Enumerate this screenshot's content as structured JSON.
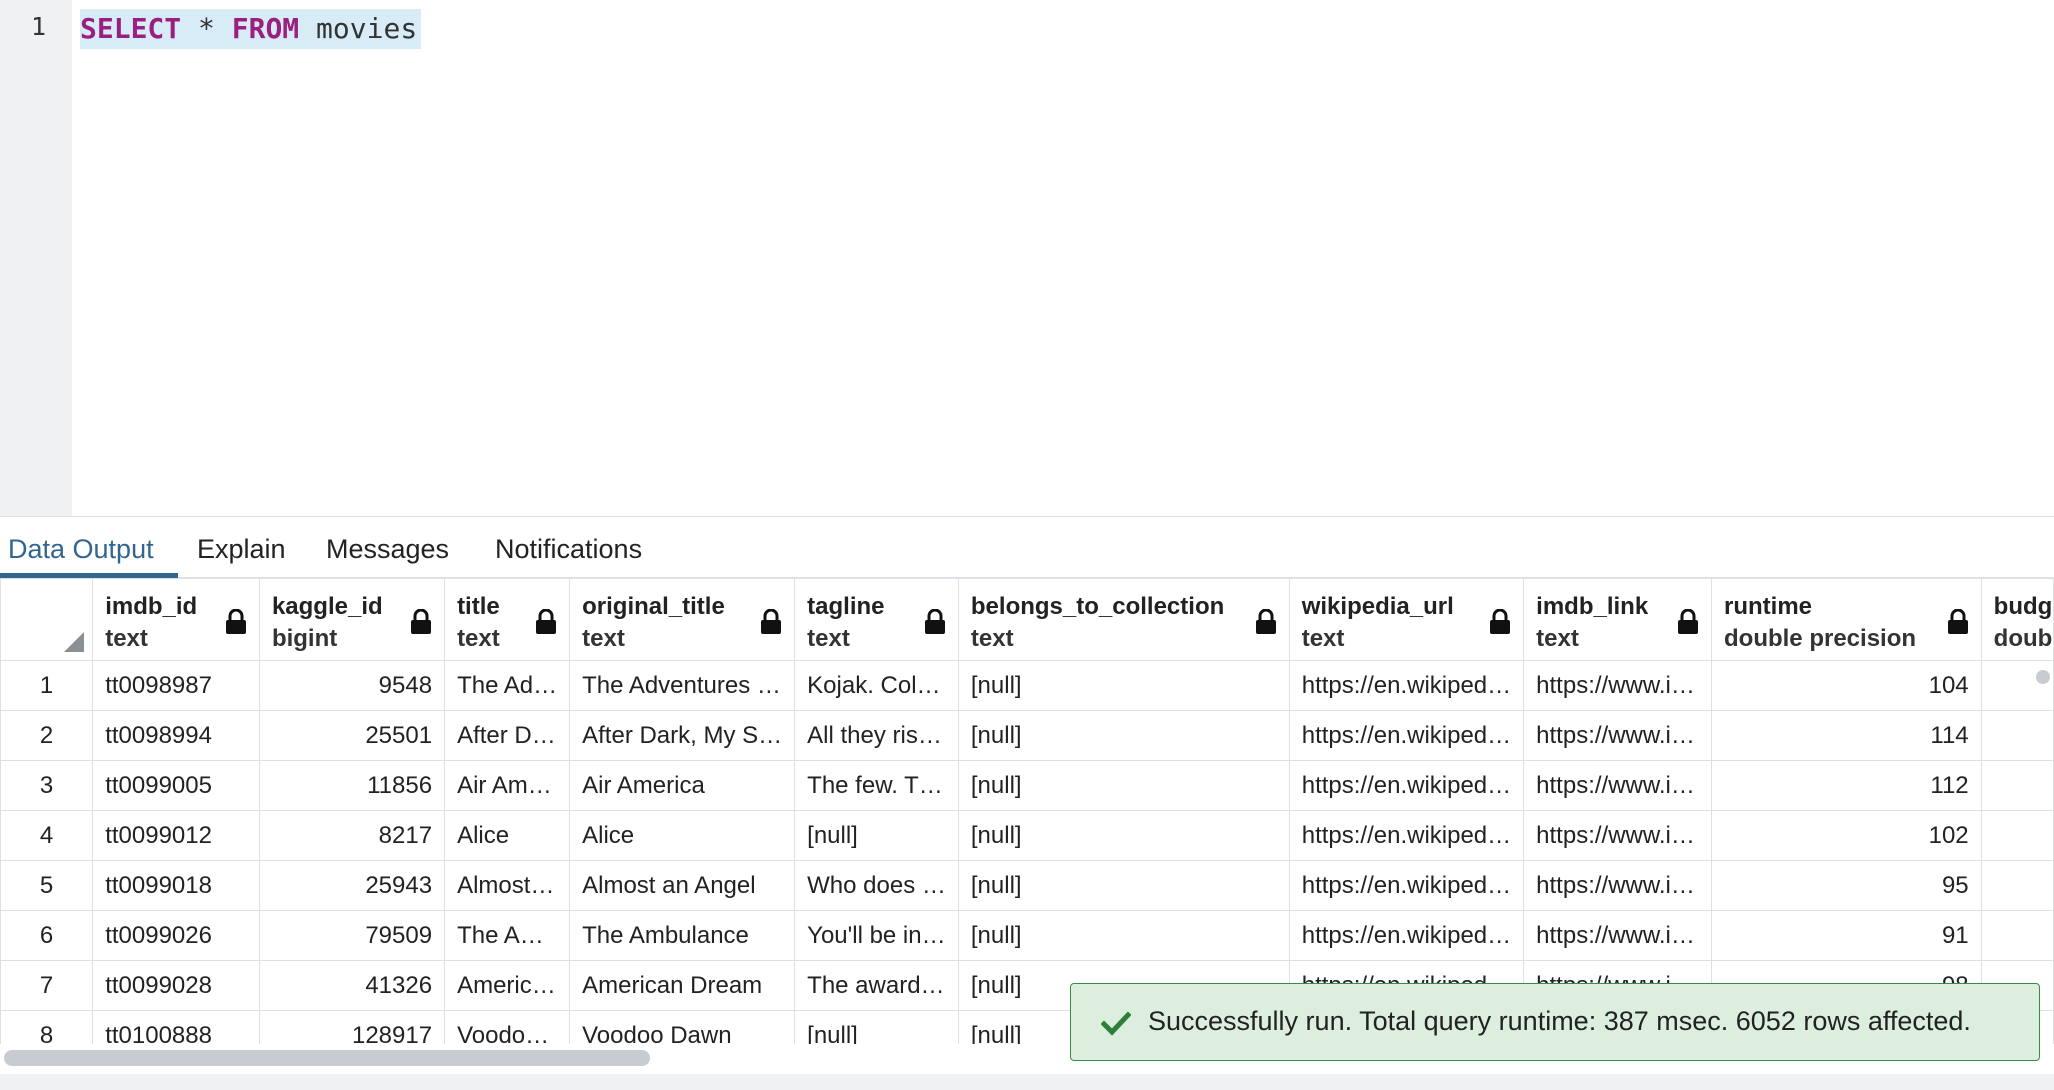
{
  "editor": {
    "line_number": "1",
    "tokens": {
      "select": "SELECT",
      "star": "*",
      "from": "FROM",
      "table": "movies"
    }
  },
  "tabs": [
    {
      "label": "Data Output",
      "active": true
    },
    {
      "label": "Explain",
      "active": false
    },
    {
      "label": "Messages",
      "active": false
    },
    {
      "label": "Notifications",
      "active": false
    }
  ],
  "grid": {
    "columns": [
      {
        "name": "imdb_id",
        "type": "text"
      },
      {
        "name": "kaggle_id",
        "type": "bigint"
      },
      {
        "name": "title",
        "type": "text"
      },
      {
        "name": "original_title",
        "type": "text"
      },
      {
        "name": "tagline",
        "type": "text"
      },
      {
        "name": "belongs_to_collection",
        "type": "text"
      },
      {
        "name": "wikipedia_url",
        "type": "text"
      },
      {
        "name": "imdb_link",
        "type": "text"
      },
      {
        "name": "runtime",
        "type": "double precision"
      },
      {
        "name": "budge",
        "type": "doubl"
      }
    ],
    "rows": [
      {
        "n": "1",
        "cells": [
          "tt0098987",
          "9548",
          "The Ad…",
          "The Adventures …",
          "Kojak. Col…",
          "[null]",
          "https://en.wikiped…",
          "https://www.i…",
          "104",
          ""
        ]
      },
      {
        "n": "2",
        "cells": [
          "tt0098994",
          "25501",
          "After D…",
          "After Dark, My S…",
          "All they ris…",
          "[null]",
          "https://en.wikiped…",
          "https://www.i…",
          "114",
          ""
        ]
      },
      {
        "n": "3",
        "cells": [
          "tt0099005",
          "11856",
          "Air Am…",
          "Air America",
          "The few. T…",
          "[null]",
          "https://en.wikiped…",
          "https://www.i…",
          "112",
          ""
        ]
      },
      {
        "n": "4",
        "cells": [
          "tt0099012",
          "8217",
          "Alice",
          "Alice",
          "[null]",
          "[null]",
          "https://en.wikiped…",
          "https://www.i…",
          "102",
          ""
        ]
      },
      {
        "n": "5",
        "cells": [
          "tt0099018",
          "25943",
          "Almost…",
          "Almost an Angel",
          "Who does …",
          "[null]",
          "https://en.wikiped…",
          "https://www.i…",
          "95",
          ""
        ]
      },
      {
        "n": "6",
        "cells": [
          "tt0099026",
          "79509",
          "The A…",
          "The Ambulance",
          "You'll be in…",
          "[null]",
          "https://en.wikiped…",
          "https://www.i…",
          "91",
          ""
        ]
      },
      {
        "n": "7",
        "cells": [
          "tt0099028",
          "41326",
          "Americ…",
          "American Dream",
          "The award…",
          "[null]",
          "https://en.wikiped…",
          "https://www.i…",
          "98",
          ""
        ]
      },
      {
        "n": "8",
        "cells": [
          "tt0100888",
          "128917",
          "Voodo…",
          "Voodoo Dawn",
          "[null]",
          "[null]",
          "",
          "",
          "",
          ""
        ]
      }
    ]
  },
  "toast": {
    "message": "Successfully run. Total query runtime: 387 msec. 6052 rows affected.",
    "icon": "checkmark-icon"
  },
  "colors": {
    "accent": "#326690",
    "keyword": "#9b1f7f",
    "null_text": "#6a7a90",
    "toast_bg": "#dcefdf",
    "toast_border": "#3b8a4a"
  }
}
